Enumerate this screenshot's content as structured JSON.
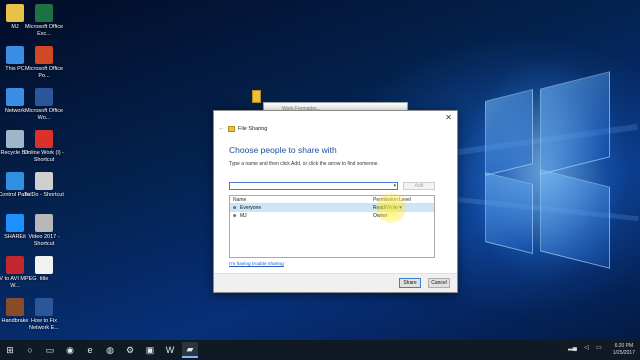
{
  "desktop_icons": [
    {
      "label": "MJ",
      "icon": "user-folder-icon",
      "color": "#e8c246"
    },
    {
      "label": "Microsoft Office Exc...",
      "icon": "excel-icon",
      "color": "#1e7145"
    },
    {
      "label": "This PC",
      "icon": "computer-icon",
      "color": "#3a8ee6"
    },
    {
      "label": "Microsoft Office Po...",
      "icon": "powerpoint-icon",
      "color": "#d24726"
    },
    {
      "label": "Network",
      "icon": "network-icon",
      "color": "#3a8ee6"
    },
    {
      "label": "Microsoft Office Wo...",
      "icon": "word-icon",
      "color": "#2b579a"
    },
    {
      "label": "Recycle Bin",
      "icon": "recycle-bin-icon",
      "color": "#9fb5c8"
    },
    {
      "label": "Online Work (I) - Shortcut",
      "icon": "shortcut-icon",
      "color": "#d9322a"
    },
    {
      "label": "Control Panel",
      "icon": "control-panel-icon",
      "color": "#2f8fe0"
    },
    {
      "label": "To Do - Shortcut",
      "icon": "shortcut-icon",
      "color": "#cfcfcf"
    },
    {
      "label": "SHAREit",
      "icon": "shareit-icon",
      "color": "#1e90ff"
    },
    {
      "label": "Video 2017 - Shortcut",
      "icon": "shortcut-icon",
      "color": "#b8b8b8"
    },
    {
      "label": "FLV to AVI MPEG W...",
      "icon": "converter-icon",
      "color": "#c4262e"
    },
    {
      "label": "title",
      "icon": "file-icon",
      "color": "#f2f2f2"
    },
    {
      "label": "Handbrake",
      "icon": "handbrake-icon",
      "color": "#8a4b2a"
    },
    {
      "label": "How to Fix Network E...",
      "icon": "word-icon",
      "color": "#2b579a"
    }
  ],
  "ghost_window": {
    "title": "Work Formatter..."
  },
  "dialog": {
    "title": "File Sharing",
    "heading": "Choose people to share with",
    "instruction": "Type a name and then click Add, or click the arrow to find someone.",
    "input_value": "",
    "add_label": "Add",
    "columns": {
      "name": "Name",
      "permission": "Permission Level"
    },
    "rows": [
      {
        "name": "Everyone",
        "permission": "Read/Write ▾",
        "selected": true
      },
      {
        "name": "MJ",
        "permission": "Owner",
        "selected": false
      }
    ],
    "trouble_link": "I'm having trouble sharing",
    "share_label": "Share",
    "cancel_label": "Cancel"
  },
  "taskbar": {
    "items": [
      {
        "icon": "start-icon",
        "glyph": "⊞"
      },
      {
        "icon": "search-icon",
        "glyph": "○"
      },
      {
        "icon": "task-view-icon",
        "glyph": "▭"
      },
      {
        "icon": "firefox-icon",
        "glyph": "◉"
      },
      {
        "icon": "edge-icon",
        "glyph": "e"
      },
      {
        "icon": "chrome-icon",
        "glyph": "◍"
      },
      {
        "icon": "settings-icon",
        "glyph": "⚙"
      },
      {
        "icon": "store-icon",
        "glyph": "▣"
      },
      {
        "icon": "word-icon",
        "glyph": "W"
      },
      {
        "icon": "file-explorer-icon",
        "glyph": "▰",
        "active": true
      }
    ],
    "time": "6:20 PM",
    "date": "1/25/2017"
  }
}
